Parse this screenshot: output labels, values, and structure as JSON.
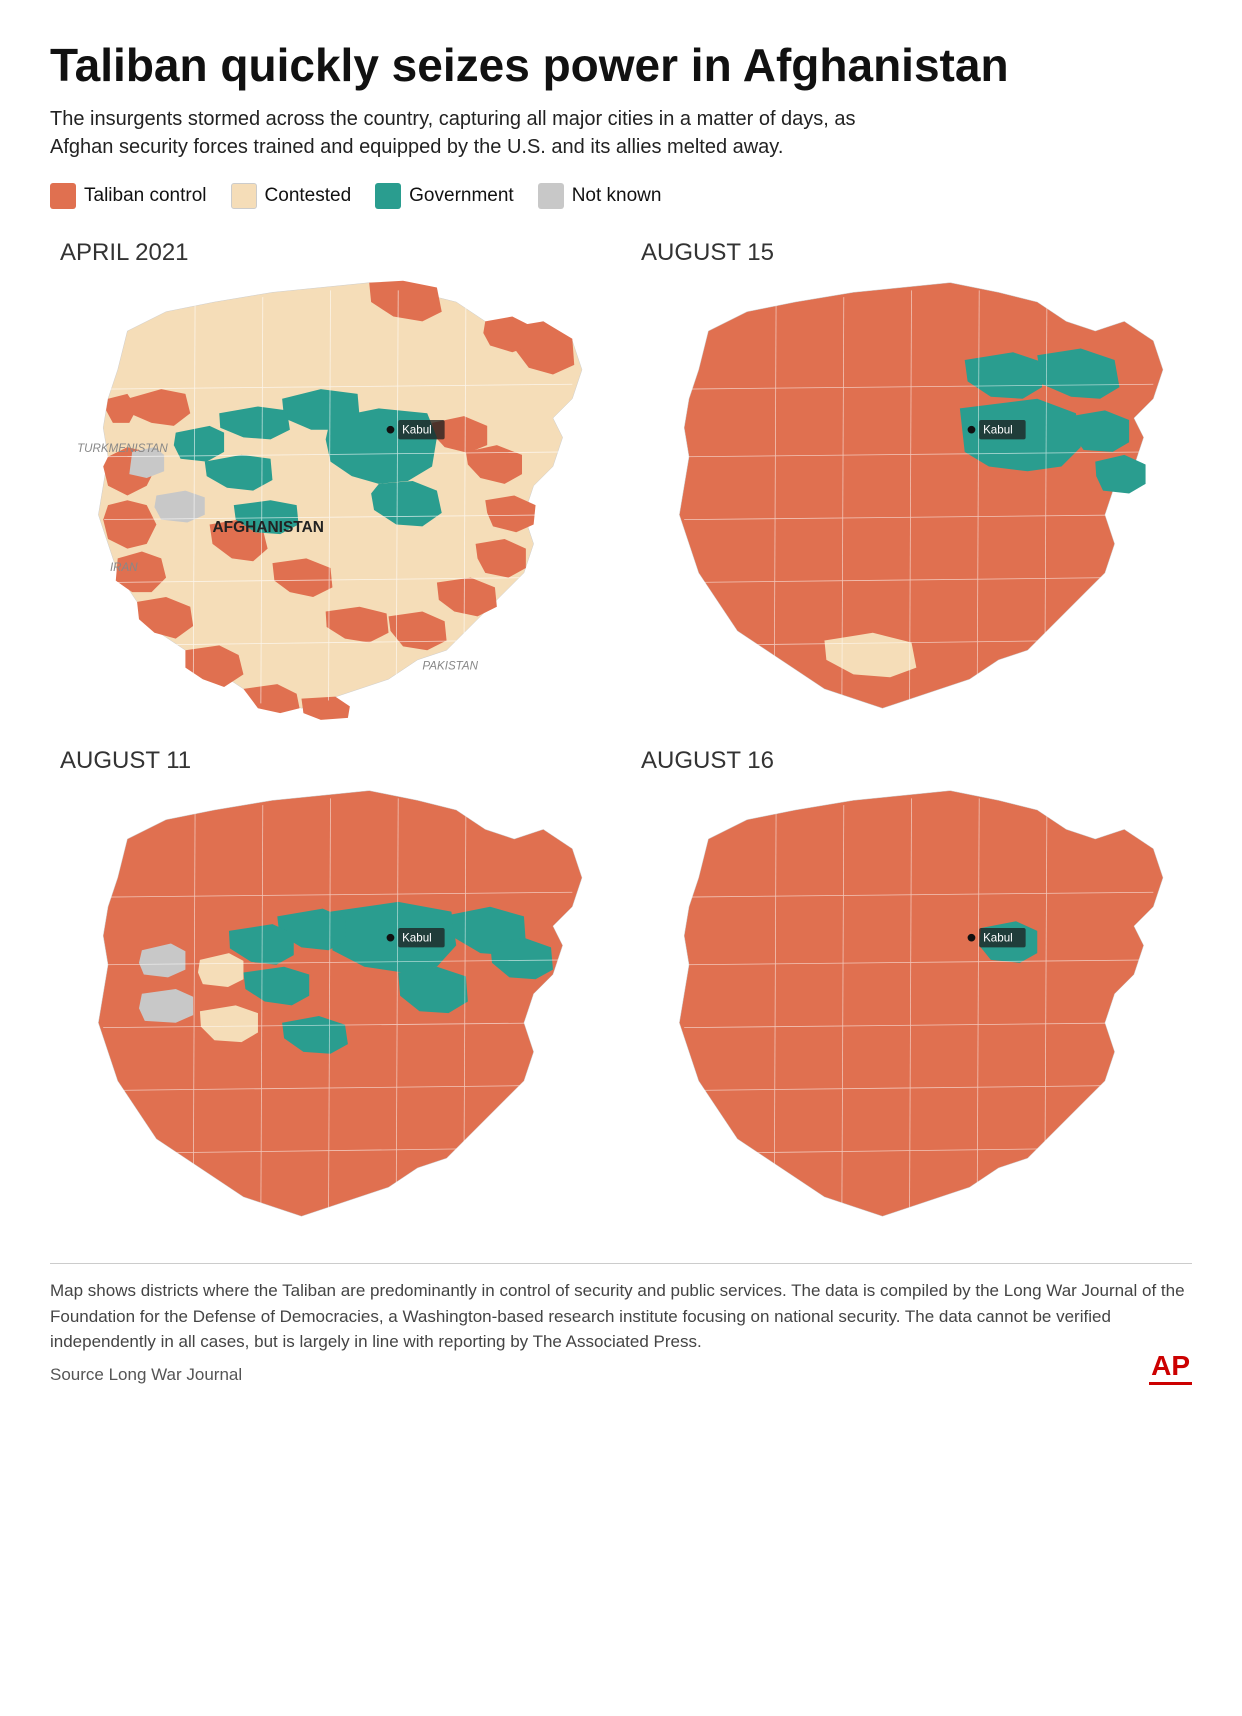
{
  "title": "Taliban quickly seizes power in Afghanistan",
  "subtitle": "The insurgents stormed across the country, capturing all major cities in a matter of days, as Afghan security forces trained and equipped by the U.S. and its allies melted away.",
  "legend": {
    "items": [
      {
        "label": "Taliban control",
        "color": "#E07050"
      },
      {
        "label": "Contested",
        "color": "#F5DDB8"
      },
      {
        "label": "Government",
        "color": "#2A9D8F"
      },
      {
        "label": "Not known",
        "color": "#C8C8C8"
      }
    ]
  },
  "maps": [
    {
      "label": "APRIL 2021",
      "id": "april2021"
    },
    {
      "label": "AUGUST 15",
      "id": "aug15"
    },
    {
      "label": "AUGUST 11",
      "id": "aug11"
    },
    {
      "label": "AUGUST 16",
      "id": "aug16"
    }
  ],
  "footnote": "Map shows districts where the Taliban are predominantly in control of security and public services. The data is compiled by the Long War Journal of the Foundation for the Defense of Democracies, a Washington-based research institute focusing on national security. The data cannot be verified independently in all cases, but is largely in line with reporting by The Associated Press.",
  "source": "Source  Long War Journal",
  "ap_logo": "AP",
  "colors": {
    "taliban": "#E07050",
    "contested": "#F5DDB8",
    "government": "#2A9D8F",
    "not_known": "#C8C8C8",
    "border": "#fff",
    "outer": "#F5DDB8"
  }
}
